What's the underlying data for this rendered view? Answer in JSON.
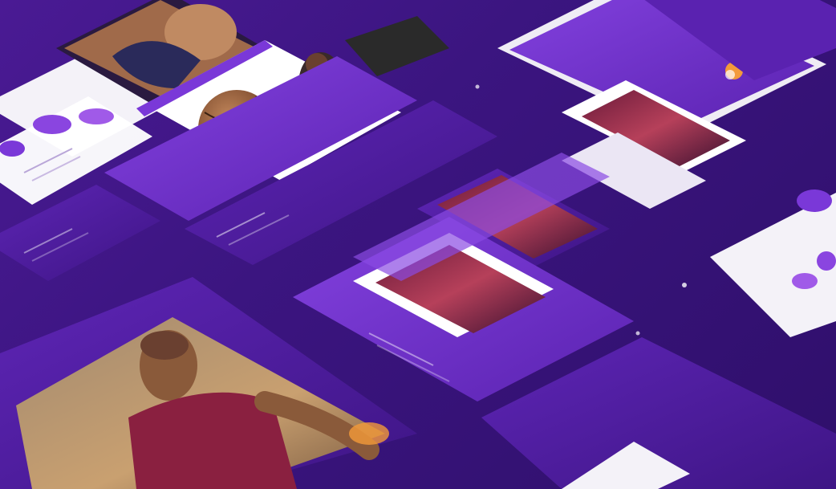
{
  "scene": {
    "headline_top": "",
    "caption_left": "",
    "caption_bottom": ""
  },
  "colors": {
    "background": "#3b1580",
    "accent_purple": "#7a38d8",
    "deep_purple": "#43178e",
    "light_panel": "#f3f1f7",
    "accent_orange": "#f39a3a"
  },
  "icons": [
    "basketball-icon",
    "player-photo-icon",
    "arena-photo-icon",
    "toggle-icon"
  ]
}
